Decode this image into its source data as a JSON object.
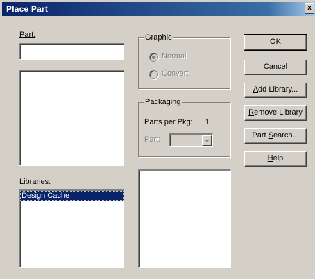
{
  "window": {
    "title": "Place Part",
    "close_glyph": "x"
  },
  "part": {
    "label": "Part:",
    "value": ""
  },
  "libraries": {
    "label": "Libraries:",
    "items": [
      "Design Cache"
    ],
    "selected_index": 0
  },
  "graphic": {
    "label": "Graphic",
    "options": [
      {
        "label": "Normal",
        "selected": true,
        "enabled": false
      },
      {
        "label": "Convert",
        "selected": false,
        "enabled": false
      }
    ]
  },
  "packaging": {
    "label": "Packaging",
    "parts_per_pkg_label": "Parts per Pkg:",
    "parts_per_pkg_value": "1",
    "part_label": "Part:",
    "part_value": ""
  },
  "buttons": {
    "ok": {
      "label": "OK",
      "accel": ""
    },
    "cancel": {
      "label": "Cancel",
      "accel": ""
    },
    "add_library": {
      "pre": "",
      "accel": "A",
      "post": "dd Library..."
    },
    "remove_library": {
      "pre": "",
      "accel": "R",
      "post": "emove Library"
    },
    "part_search": {
      "pre": "Part ",
      "accel": "S",
      "post": "earch..."
    },
    "help": {
      "pre": "",
      "accel": "H",
      "post": "elp"
    }
  }
}
